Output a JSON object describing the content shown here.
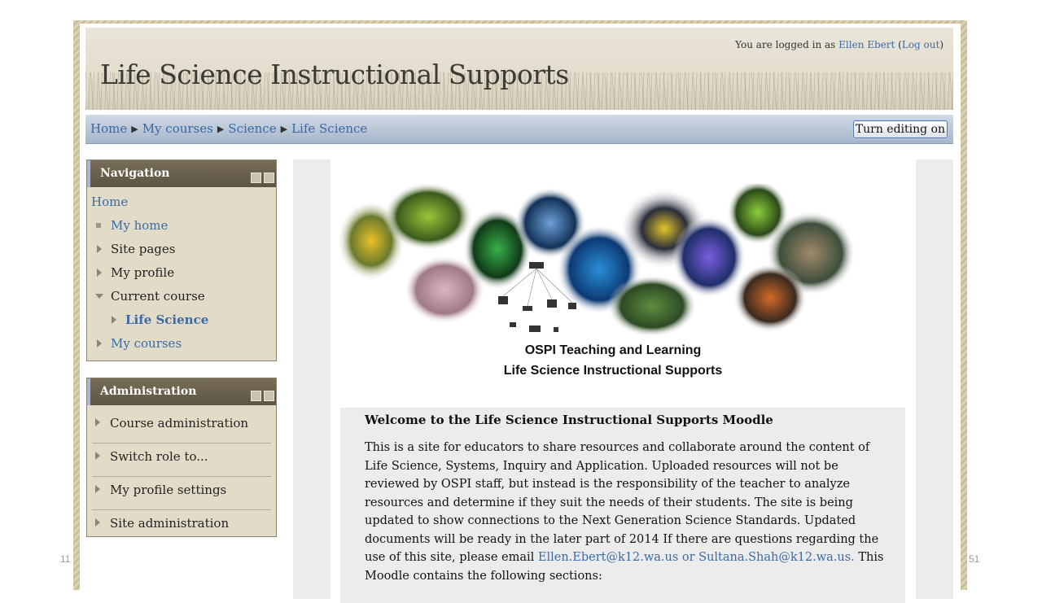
{
  "slide": {
    "left_number": "11",
    "right_number": "51"
  },
  "header": {
    "title": "Life Science Instructional Supports",
    "login_prefix": "You are logged in as",
    "user_name": "Ellen Ebert",
    "logout_label": "Log out"
  },
  "breadcrumb": {
    "items": [
      "Home",
      "My courses",
      "Science",
      "Life Science"
    ],
    "edit_button": "Turn editing on"
  },
  "navigation": {
    "title": "Navigation",
    "items": [
      "Home",
      "My home",
      "Site pages",
      "My profile",
      "Current course",
      "Life Science",
      "My courses"
    ]
  },
  "administration": {
    "title": "Administration",
    "items": [
      "Course administration",
      "Switch role to...",
      "My profile settings",
      "Site administration"
    ]
  },
  "main": {
    "banner_line1": "OSPI Teaching and Learning",
    "banner_line2": "Life Science Instructional Supports",
    "welcome_title": "Welcome to the  Life Science Instructional Supports Moodle",
    "welcome_text": "This is a site for educators to share resources and collaborate around the content of Life Science, Systems, Inquiry and Application.  Uploaded resources will not be reviewed by OSPI staff, but instead is the responsibility of the teacher to analyze resources and determine if they suit the needs of their students.  The site is being updated to show connections to the Next Generation Science Standards. Updated documents will be ready in the later part of 2014 If there are questions regarding the use of this site, please email",
    "emails": "Ellen.Ebert@k12.wa.us or Sultana.Shah@k12.wa.us.",
    "welcome_text_end": " This Moodle contains the following sections:"
  },
  "colors": {
    "link": "#3c6aa6",
    "block_header": "#675e4b",
    "block_body": "#e1dbc8",
    "navbar": "#b9c6d6"
  }
}
